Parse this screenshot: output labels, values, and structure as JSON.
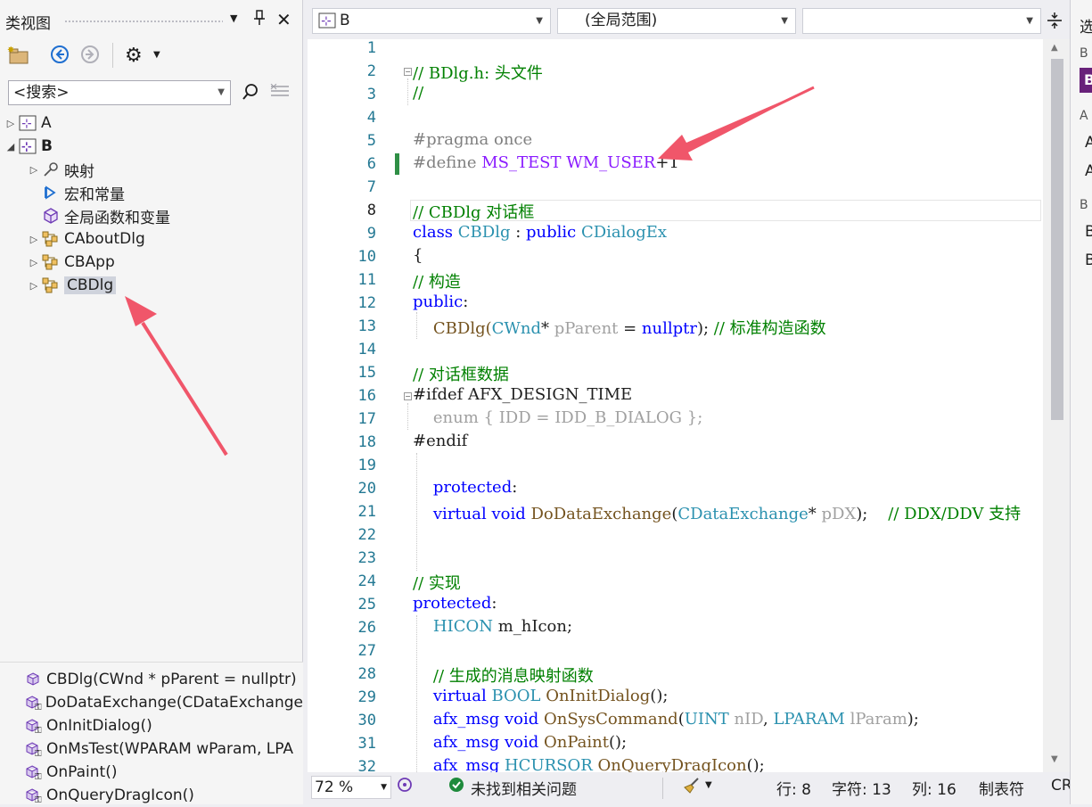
{
  "class_view": {
    "title": "类视图",
    "search_placeholder": "<搜索>",
    "tree": [
      {
        "label": "A",
        "expanded": false,
        "bold": false
      },
      {
        "label": "B",
        "expanded": true,
        "bold": true
      },
      {
        "label": "映射",
        "expanded": false
      },
      {
        "label": "宏和常量"
      },
      {
        "label": "全局函数和变量"
      },
      {
        "label": "CAboutDlg",
        "expanded": false
      },
      {
        "label": "CBApp",
        "expanded": false
      },
      {
        "label": "CBDlg",
        "expanded": false,
        "selected": true
      }
    ],
    "members": [
      "CBDlg(CWnd * pParent = nullptr)",
      "DoDataExchange(CDataExchange",
      "OnInitDialog()",
      "OnMsTest(WPARAM wParam, LPA",
      "OnPaint()",
      "OnQueryDragIcon()"
    ]
  },
  "editor": {
    "project_combo": "B",
    "scope_combo": "(全局范围)",
    "member_combo": "",
    "current_line": 8,
    "line_numbers": [
      "1",
      "2",
      "3",
      "4",
      "5",
      "6",
      "7",
      "8",
      "9",
      "10",
      "11",
      "12",
      "13",
      "14",
      "15",
      "16",
      "17",
      "18",
      "19",
      "20",
      "21",
      "22",
      "23",
      "24",
      "25",
      "26",
      "27",
      "28",
      "29",
      "30",
      "31",
      "32"
    ],
    "code": {
      "l2": "// BDlg.h: 头文件",
      "l3": "//",
      "l5": "#pragma once",
      "l6_a": "#define ",
      "l6_b": "MS_TEST",
      "l6_c": " ",
      "l6_d": "WM_USER",
      "l6_e": "+1",
      "l8": "// CBDlg 对话框",
      "l9_a": "class ",
      "l9_b": "CBDlg",
      "l9_c": " : ",
      "l9_d": "public ",
      "l9_e": "CDialogEx",
      "l10": "{",
      "l11": "// 构造",
      "l12_a": "public",
      "l12_b": ":",
      "l13_a": "    CBDlg(",
      "l13_b": "CWnd",
      "l13_c": "* ",
      "l13_d": "pParent",
      "l13_e": " = ",
      "l13_f": "nullptr",
      "l13_g": "); ",
      "l13_h": "// 标准构造函数",
      "l15": "// 对话框数据",
      "l16": "#ifdef AFX_DESIGN_TIME",
      "l17": "    enum { IDD = IDD_B_DIALOG };",
      "l18": "#endif",
      "l20_a": "    protected",
      "l20_b": ":",
      "l21_a": "    virtual ",
      "l21_b": "void ",
      "l21_c": "DoDataExchange",
      "l21_d": "(",
      "l21_e": "CDataExchange",
      "l21_f": "* ",
      "l21_g": "pDX",
      "l21_h": ");    ",
      "l21_i": "// DDX/DDV 支持",
      "l24": "// 实现",
      "l25_a": "protected",
      "l25_b": ":",
      "l26_a": "    HICON ",
      "l26_b": "m_hIcon;",
      "l28": "    // 生成的消息映射函数",
      "l29_a": "    virtual ",
      "l29_b": "BOOL ",
      "l29_c": "OnInitDialog",
      "l29_d": "();",
      "l30_a": "    afx_msg ",
      "l30_b": "void ",
      "l30_c": "OnSysCommand",
      "l30_d": "(",
      "l30_e": "UINT ",
      "l30_f": "nID",
      "l30_g": ", ",
      "l30_h": "LPARAM ",
      "l30_i": "lParam",
      "l30_j": ");",
      "l31_a": "    afx_msg ",
      "l31_b": "void ",
      "l31_c": "OnPaint",
      "l31_d": "();",
      "l32_a": "    afx_msg ",
      "l32_b": "HCURSOR ",
      "l32_c": "OnQueryDragIcon",
      "l32_d": "();"
    }
  },
  "status_bar": {
    "zoom": "72 %",
    "issues": "未找到相关问题",
    "line": "行: 8",
    "char": "字符: 13",
    "col": "列: 16",
    "indent": "制表符",
    "eol": "CR"
  },
  "right_panel": {
    "title": "选",
    "items": [
      "B",
      "A",
      "A",
      "A",
      "B",
      "B",
      "B"
    ]
  },
  "colors": {
    "keyword": "#0000ff",
    "type": "#2b91af",
    "comment": "#008000",
    "macro": "#8a1bff",
    "preprocessor": "#808080",
    "annotation_arrow": "#f0566a"
  }
}
